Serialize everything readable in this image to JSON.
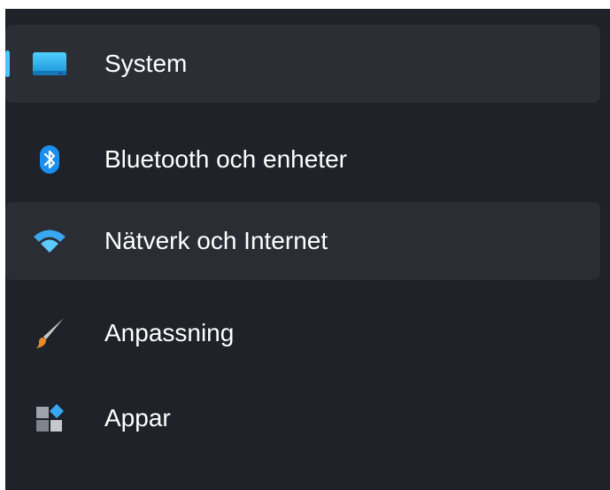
{
  "sidebar": {
    "items": [
      {
        "label": "System",
        "icon": "monitor-icon",
        "state": "selected"
      },
      {
        "label": "Bluetooth och enheter",
        "icon": "bluetooth-icon",
        "state": "normal"
      },
      {
        "label": "Nätverk och Internet",
        "icon": "wifi-icon",
        "state": "hover"
      },
      {
        "label": "Anpassning",
        "icon": "paintbrush-icon",
        "state": "normal"
      },
      {
        "label": "Appar",
        "icon": "apps-icon",
        "state": "normal"
      }
    ]
  },
  "colors": {
    "background": "#1f2229",
    "selected_item": "#2b2e35",
    "hover_item": "#2a2d34",
    "accent": "#4cc2ff",
    "text": "#ffffff"
  }
}
